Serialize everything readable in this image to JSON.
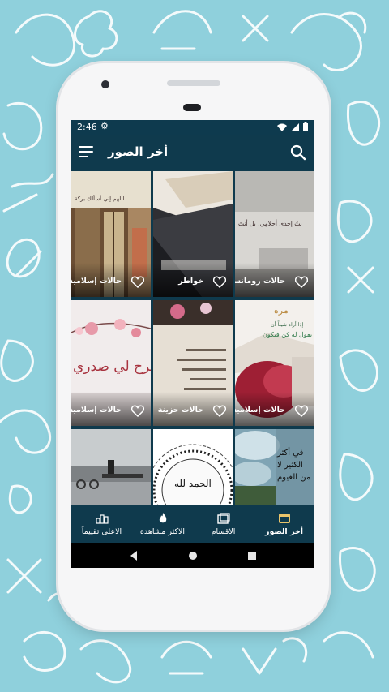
{
  "status_bar": {
    "time": "2:46",
    "settings_icon": "gear-icon",
    "wifi_icon": "wifi-icon",
    "signal_icon": "signal-icon",
    "battery_icon": "battery-icon"
  },
  "app_bar": {
    "title": "أخر الصور",
    "menu_icon": "hamburger-menu-icon",
    "search_icon": "search-icon",
    "background": "#0f3a4d"
  },
  "grid": {
    "tiles": [
      {
        "label": "حالات إسلامية"
      },
      {
        "label": "خواطر"
      },
      {
        "label": "حالات رومانسية"
      },
      {
        "label": "حالات إسلامية"
      },
      {
        "label": "حالات حزينة"
      },
      {
        "label": "حالات إسلامية"
      },
      {
        "label": ""
      },
      {
        "label": ""
      },
      {
        "label": ""
      }
    ],
    "artwork_text": {
      "t1": "اللهم إني أسألك بركة",
      "t3a": "بتُ إحدى أحلامِي، بل أنتَ",
      "t3b": "— —",
      "t4": "ربِّ اشرح لي صدري",
      "t6a": "مره",
      "t6b": "إذا أراد شيئاً أن",
      "t6c": "يقول له كن فيكون",
      "t8": "الحمد لله",
      "t9": "في أكثر\nالكثير لا\nمن الغيوم"
    }
  },
  "bottom_nav": {
    "items": [
      {
        "label": "أخر الصور",
        "icon": "image-icon"
      },
      {
        "label": "الاقسام",
        "icon": "folders-icon"
      },
      {
        "label": "الاكثر مشاهدة",
        "icon": "fire-icon"
      },
      {
        "label": "الاعلى تقييماً",
        "icon": "ranking-icon"
      }
    ]
  },
  "system_nav": {
    "back_icon": "back-triangle-icon",
    "home_icon": "home-circle-icon",
    "recents_icon": "recents-square-icon"
  },
  "colors": {
    "background": "#8fd0dc",
    "doodle": "#ffffff",
    "primary": "#0f3a4d"
  }
}
